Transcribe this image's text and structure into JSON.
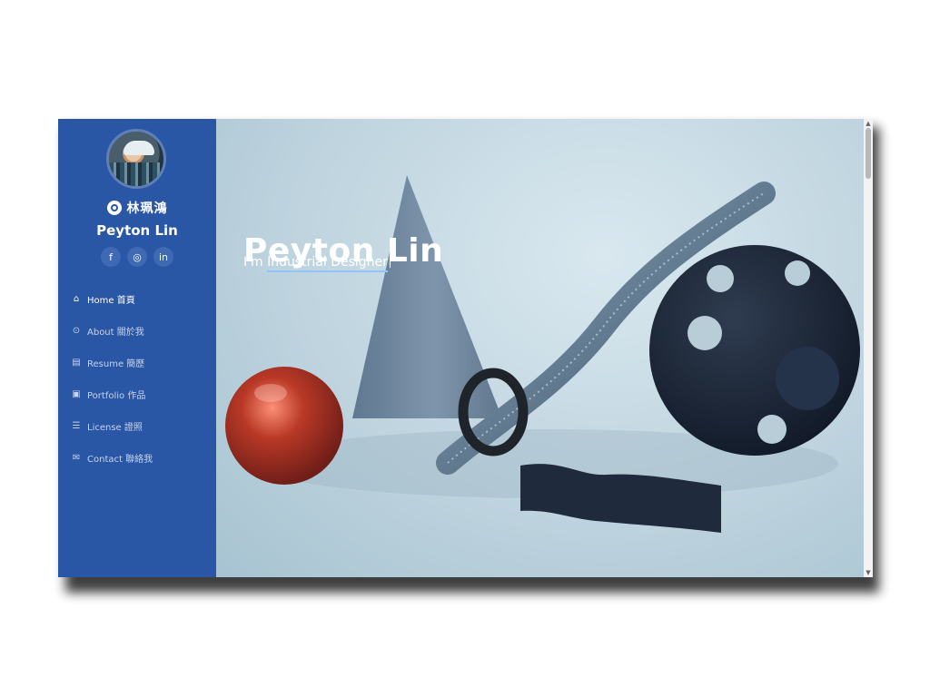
{
  "profile": {
    "name_cn": "林珮鴻",
    "name_en": "Peyton Lin",
    "avatar": "portrait-avatar",
    "logo": "circular-emblem-icon"
  },
  "social": [
    {
      "name": "facebook",
      "icon": "facebook-icon",
      "glyph": "f"
    },
    {
      "name": "instagram",
      "icon": "instagram-icon",
      "glyph": "◎"
    },
    {
      "name": "linkedin",
      "icon": "linkedin-icon",
      "glyph": "in"
    }
  ],
  "nav": [
    {
      "label": "Home 首頁",
      "icon": "home-icon",
      "glyph": "⌂",
      "active": true
    },
    {
      "label": "About 關於我",
      "icon": "user-icon",
      "glyph": "⊙",
      "active": false
    },
    {
      "label": "Resume 簡歷",
      "icon": "document-icon",
      "glyph": "▤",
      "active": false
    },
    {
      "label": "Portfolio 作品",
      "icon": "image-icon",
      "glyph": "▣",
      "active": false
    },
    {
      "label": "License 證照",
      "icon": "server-icon",
      "glyph": "☰",
      "active": false
    },
    {
      "label": "Contact 聯絡我",
      "icon": "envelope-icon",
      "glyph": "✉",
      "active": false
    }
  ],
  "hero": {
    "title": "Peyton Lin",
    "prefix": "I'm ",
    "typed": "Industrial Designer",
    "background": "abstract-3d-objects-render"
  },
  "colors": {
    "sidebar": "#2a56a6",
    "hero_background": "#bfd4df",
    "accent": "#8fc4ff"
  }
}
